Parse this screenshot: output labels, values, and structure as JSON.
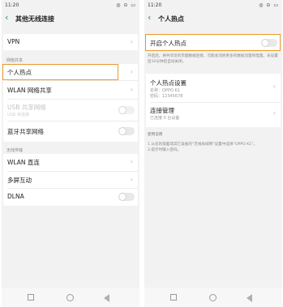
{
  "left": {
    "status": {
      "time": "11:20",
      "signal": "░░≡",
      "icons": "◎ ⊙ ▭"
    },
    "title": "其他无线连接",
    "vpn": {
      "label": "VPN"
    },
    "section_network_share": "网络共享",
    "hotspot": {
      "label": "个人热点"
    },
    "wlan_share": {
      "label": "WLAN 网络共享"
    },
    "usb_share": {
      "label": "USB 共享网络",
      "sub": "USB 未连接"
    },
    "bt_share": {
      "label": "蓝牙共享网络"
    },
    "section_wireless": "无线传输",
    "wlan_direct": {
      "label": "WLAN 直连"
    },
    "multiscreen": {
      "label": "多屏互动"
    },
    "dlna": {
      "label": "DLNA"
    }
  },
  "right": {
    "status": {
      "time": "11:20",
      "signal": "░░≡",
      "icons": "◎ ⊙ ▭"
    },
    "title": "个人热点",
    "enable_hotspot": {
      "label": "开启个人热点"
    },
    "hotspot_desc": "开启后，将共享您的页面数据连接，可能会消耗更多的数据流量和电量。未设置后10分钟后自动关闭。",
    "hotspot_settings": {
      "label": "个人热点设置",
      "name": "名称：OPPO K1",
      "password": "密码：12345678"
    },
    "connection_mgmt": {
      "label": "连接管理",
      "sub": "已连接 0 台设备"
    },
    "help_title": "使用说明",
    "help_text": "1.从您的电脑或其它设备的“无线局域网”设置中选择“OPPO K1”。\n2.提示时输入密码。"
  },
  "nav": {
    "chevron": "›"
  },
  "colors": {
    "accent": "#2a8a62",
    "highlight": "#e89a2c"
  },
  "icons": [
    "back-icon",
    "chevron-right-icon",
    "toggle-switch",
    "recent-apps-icon",
    "home-icon",
    "back-nav-icon"
  ]
}
